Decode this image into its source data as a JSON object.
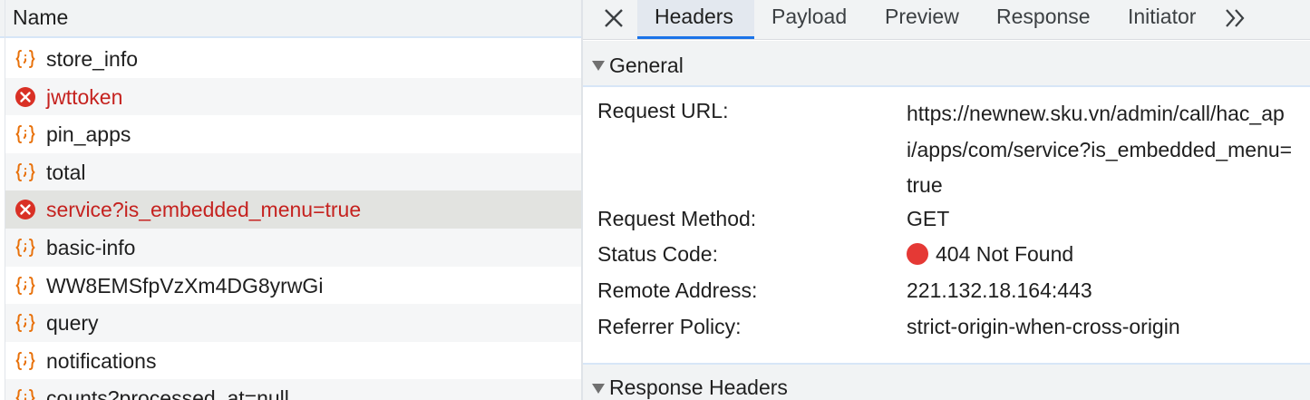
{
  "request_list": {
    "column_header": "Name",
    "rows": [
      {
        "label": "store_info",
        "status": "ok"
      },
      {
        "label": "jwttoken",
        "status": "error"
      },
      {
        "label": "pin_apps",
        "status": "ok"
      },
      {
        "label": "total",
        "status": "ok"
      },
      {
        "label": "service?is_embedded_menu=true",
        "status": "error",
        "selected": true
      },
      {
        "label": "basic-info",
        "status": "ok"
      },
      {
        "label": "WW8EMSfpVzXm4DG8yrwGi",
        "status": "ok"
      },
      {
        "label": "query",
        "status": "ok"
      },
      {
        "label": "notifications",
        "status": "ok"
      },
      {
        "label": "counts?processed_at=null",
        "status": "ok"
      }
    ]
  },
  "detail_tabs": {
    "close_icon": "close-icon",
    "tabs": [
      "Headers",
      "Payload",
      "Preview",
      "Response",
      "Initiator"
    ],
    "active_tab": "Headers",
    "more_icon": "chevron-double-right-icon"
  },
  "general": {
    "title": "General",
    "request_url_label": "Request URL:",
    "request_url_lines": [
      "https://newnew.sku.vn/admin/call/hac_ap",
      "i/apps/com/service?is_embedded_menu=",
      "true"
    ],
    "request_method_label": "Request Method:",
    "request_method_value": "GET",
    "status_code_label": "Status Code:",
    "status_code_value": "404 Not Found",
    "status_color": "#e53935",
    "remote_address_label": "Remote Address:",
    "remote_address_value": "221.132.18.164:443",
    "referrer_policy_label": "Referrer Policy:",
    "referrer_policy_value": "strict-origin-when-cross-origin"
  },
  "response_headers": {
    "title": "Response Headers"
  },
  "colors": {
    "error_text": "#c5221f",
    "accent": "#1a73e8",
    "xhr_icon": "#e8710a",
    "error_icon": "#d93025"
  }
}
